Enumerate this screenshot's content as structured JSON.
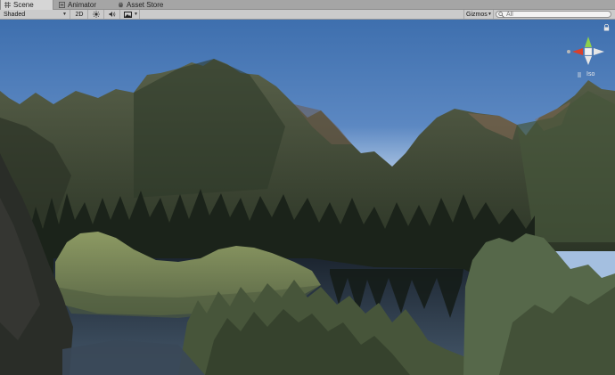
{
  "tabs": [
    {
      "label": "Scene",
      "icon": "scene-grid-icon",
      "active": true
    },
    {
      "label": "Animator",
      "icon": "animator-icon",
      "active": false
    },
    {
      "label": "Asset Store",
      "icon": "asset-store-icon",
      "active": false
    }
  ],
  "toolbar": {
    "shading_mode": "Shaded",
    "mode_2d": "2D",
    "lighting_icon": "sun-icon",
    "audio_icon": "speaker-icon",
    "effects_icon": "image-effects-icon",
    "gizmos_label": "Gizmos",
    "search_placeholder": "All",
    "search_icon": "search-icon"
  },
  "gizmo": {
    "projection_label": "Iso",
    "axis_colors": {
      "x": "#d9402b",
      "y": "#8fd14a",
      "z": "#3d7fd6"
    }
  },
  "colors": {
    "sky_top": "#3f6fae",
    "sky_bottom": "#a9c3e2",
    "tab_bar": "#a5a5a5",
    "toolbar": "#cbcbcb"
  }
}
